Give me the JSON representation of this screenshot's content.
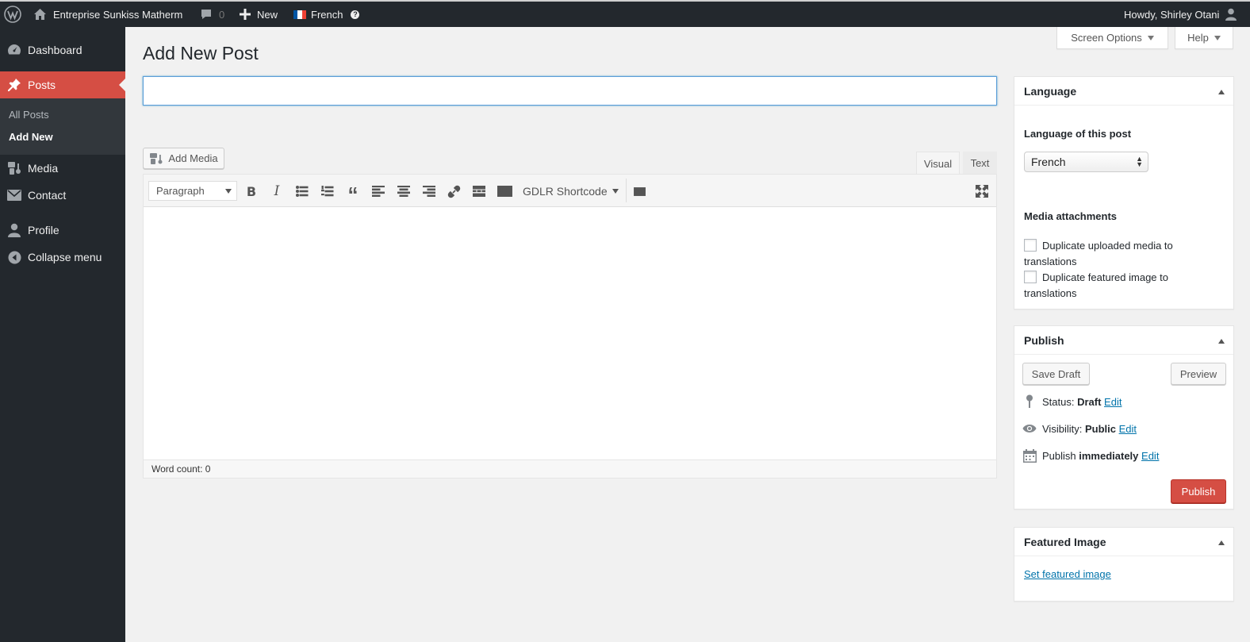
{
  "adminbar": {
    "site_name": "Entreprise Sunkiss Matherm",
    "comments_count": "0",
    "new_label": "New",
    "language_label": "French",
    "howdy": "Howdy, Shirley Otani"
  },
  "sidebar": {
    "items": [
      {
        "label": "Dashboard",
        "icon": "dashboard-icon"
      },
      {
        "label": "Posts",
        "icon": "pushpin-icon"
      },
      {
        "label": "Media",
        "icon": "media-icon"
      },
      {
        "label": "Contact",
        "icon": "envelope-icon"
      },
      {
        "label": "Profile",
        "icon": "user-icon"
      },
      {
        "label": "Collapse menu",
        "icon": "collapse-icon"
      }
    ],
    "submenu": [
      "All Posts",
      "Add New"
    ]
  },
  "screen_options": {
    "screen_options_label": "Screen Options",
    "help_label": "Help"
  },
  "page": {
    "title": "Add New Post",
    "title_value": ""
  },
  "editor": {
    "add_media_label": "Add Media",
    "tab_visual": "Visual",
    "tab_text": "Text",
    "format_value": "Paragraph",
    "shortcode_label": "GDLR Shortcode",
    "word_count": "Word count: 0"
  },
  "language_box": {
    "title": "Language",
    "language_of_post": "Language of this post",
    "selected_language": "French",
    "media_attachments": "Media attachments",
    "dup_media_line1": "Duplicate uploaded media to",
    "dup_media_line2": "translations",
    "dup_featured_line1": "Duplicate featured image to",
    "dup_featured_line2": "translations"
  },
  "publish_box": {
    "title": "Publish",
    "save_draft": "Save Draft",
    "preview": "Preview",
    "status_label": "Status: ",
    "status_value": "Draft",
    "visibility_label": "Visibility: ",
    "visibility_value": "Public",
    "publish_label": "Publish ",
    "publish_value": "immediately",
    "edit_link": "Edit",
    "publish_button": "Publish"
  },
  "featured_box": {
    "title": "Featured Image",
    "set_link": "Set featured image"
  },
  "colors": {
    "accent": "#d54e44",
    "adminbar": "#23282d",
    "link": "#0073aa"
  }
}
